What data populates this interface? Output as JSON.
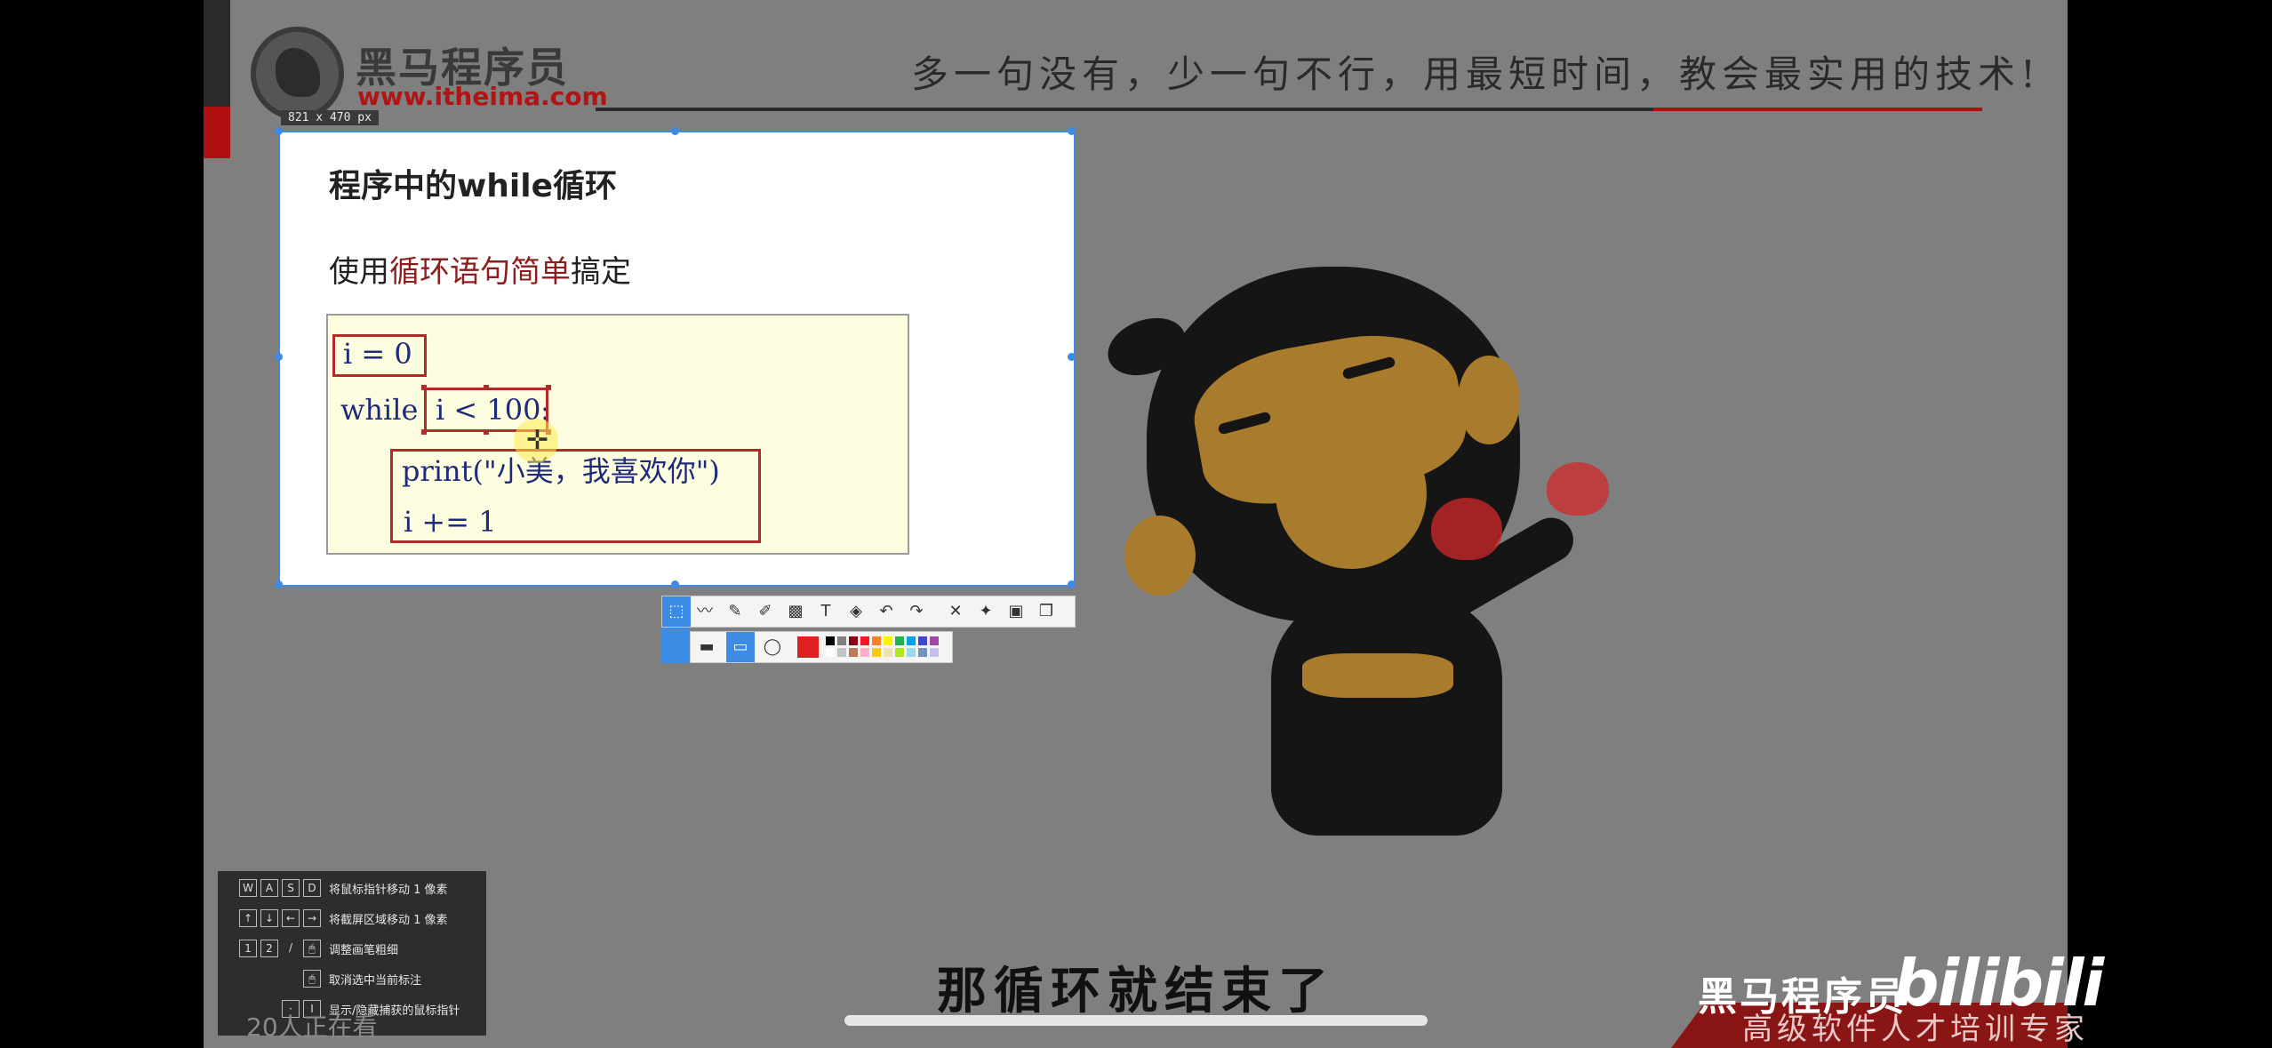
{
  "brand": {
    "logo_text": "黑马程序员",
    "url": "www.itheima.com",
    "slogan": "多一句没有，少一句不行，用最短时间，教会最实用的技术!"
  },
  "screenshot_tool": {
    "size_label": "821 x 470  px",
    "toolbar_icons": [
      "select-icon",
      "polyline-icon",
      "pen-icon",
      "marker-icon",
      "mosaic-icon",
      "text-icon",
      "eraser-icon",
      "undo-icon",
      "redo-icon",
      "close-icon",
      "pin-icon",
      "save-icon",
      "copy-icon"
    ],
    "shape_icons": [
      "filled-rect-icon",
      "rect-icon",
      "ellipse-icon"
    ],
    "current_color": "#e02020",
    "palette": [
      "#000000",
      "#7f7f7f",
      "#880015",
      "#ed1c24",
      "#ff7f27",
      "#fff200",
      "#22b14c",
      "#00a2e8",
      "#3f48cc",
      "#a349a4",
      "#ffffff",
      "#c3c3c3",
      "#b97a57",
      "#ffaec9",
      "#ffc90e",
      "#efe4b0",
      "#b5e61d",
      "#99d9ea",
      "#7092be",
      "#c8bfe7"
    ]
  },
  "slide": {
    "title": "程序中的while循环",
    "subtitle_prefix": "使用",
    "subtitle_highlight": "循环语句简单",
    "subtitle_suffix": "搞定",
    "code": {
      "line1": "i = 0",
      "line2_kw": "while",
      "line2_cond": "i < 100",
      "line2_colon": ":",
      "line3": "print(\"小美，我喜欢你\")",
      "line4": "i += 1"
    }
  },
  "hotkeys": [
    {
      "keys": [
        "W",
        "A",
        "S",
        "D"
      ],
      "desc": "将鼠标指针移动 1 像素"
    },
    {
      "keys": [
        "↑",
        "↓",
        "←",
        "→"
      ],
      "desc": "将截屏区域移动 1 像素"
    },
    {
      "keys": [
        "1",
        "2",
        "/",
        "🖱"
      ],
      "desc": "调整画笔粗细"
    },
    {
      "keys": [
        "🖱"
      ],
      "desc": "取消选中当前标注"
    },
    {
      "keys": [
        "·",
        "I"
      ],
      "desc": "显示/隐藏捕获的鼠标指针"
    }
  ],
  "viewers": "20人正在看",
  "caption": "那循环就结束了",
  "watermark": {
    "name": "黑马程序员",
    "platform": "bilibili",
    "tagline": "高级软件人才培训专家"
  }
}
